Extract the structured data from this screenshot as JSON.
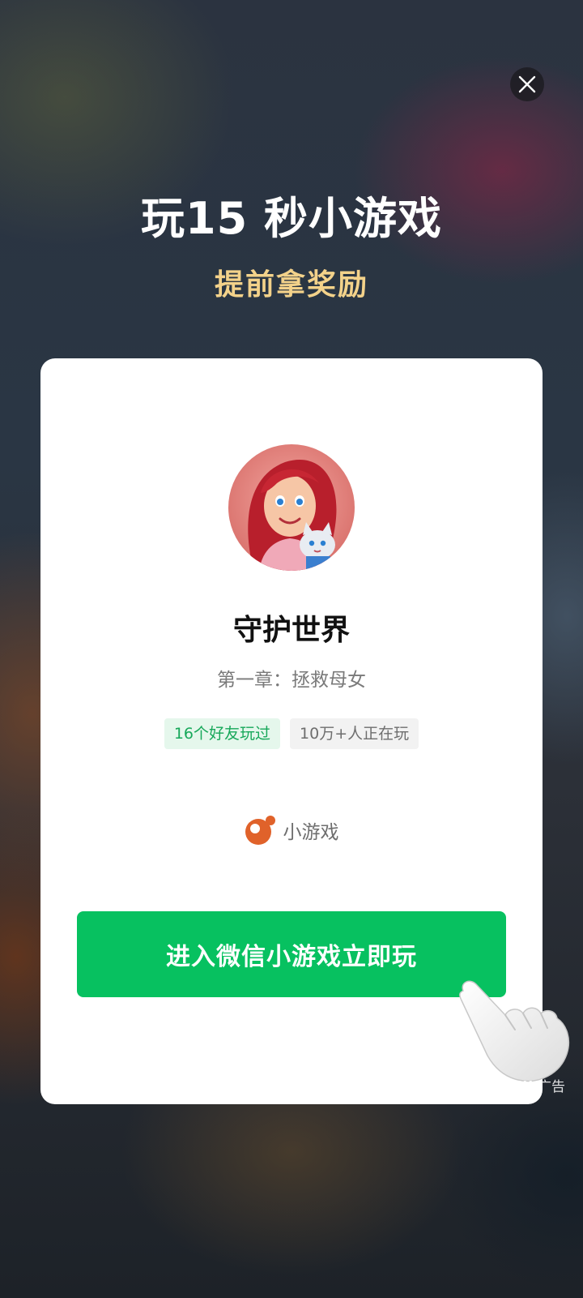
{
  "headline": "玩15 秒小游戏",
  "subline": "提前拿奖励",
  "card": {
    "title": "守护世界",
    "subtitle": "第一章：拯救母女",
    "tags": [
      "16个好友玩过",
      "10万+人正在玩"
    ],
    "brand_label": "小游戏",
    "cta_label": "进入微信小游戏立即玩"
  },
  "ad_label": "广告",
  "icons": {
    "close": "close-icon",
    "brand": "mini-game-logo-icon",
    "hand": "pointing-hand-icon",
    "ad": "ad-logo-icon"
  },
  "colors": {
    "accent_green": "#07c160",
    "subline_gold": "#f3d28a",
    "tag_green_text": "#17a85a",
    "brand_orange": "#e0622a"
  }
}
